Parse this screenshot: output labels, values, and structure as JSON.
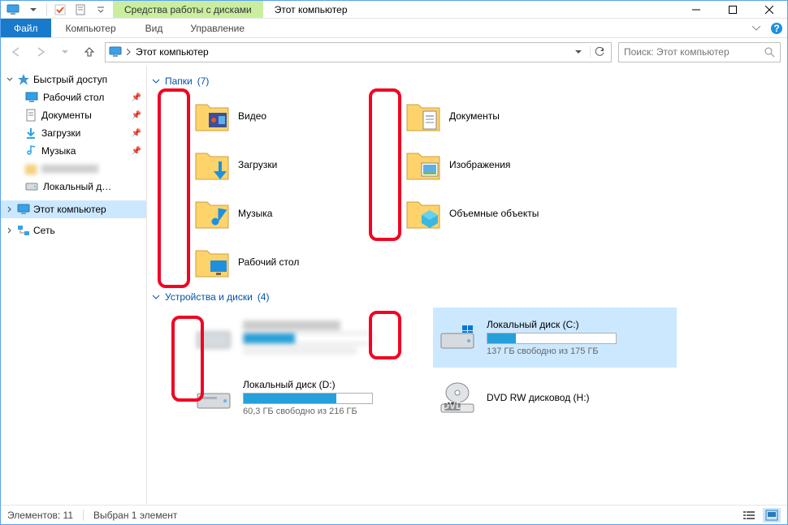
{
  "titlebar": {
    "tools_tab": "Средства работы с дисками",
    "title": "Этот компьютер"
  },
  "ribbon": {
    "file": "Файл",
    "computer": "Компьютер",
    "view": "Вид",
    "manage": "Управление"
  },
  "address": {
    "current": "Этот компьютер"
  },
  "search": {
    "placeholder": "Поиск: Этот компьютер"
  },
  "sidebar": {
    "quick": "Быстрый доступ",
    "quick_items": [
      {
        "label": "Рабочий стол",
        "icon": "desktop"
      },
      {
        "label": "Документы",
        "icon": "doc"
      },
      {
        "label": "Загрузки",
        "icon": "download"
      },
      {
        "label": "Музыка",
        "icon": "music"
      },
      {
        "label": "",
        "icon": "blur"
      },
      {
        "label": "Локальный диск",
        "icon": "drive"
      }
    ],
    "this_pc": "Этот компьютер",
    "network": "Сеть"
  },
  "groups": {
    "folders": {
      "label": "Папки",
      "count": "(7)"
    },
    "drives": {
      "label": "Устройства и диски",
      "count": "(4)"
    }
  },
  "folders_col1": [
    {
      "label": "Видео"
    },
    {
      "label": "Загрузки"
    },
    {
      "label": "Музыка"
    },
    {
      "label": "Рабочий стол"
    }
  ],
  "folders_col2": [
    {
      "label": "Документы"
    },
    {
      "label": "Изображения"
    },
    {
      "label": "Объемные объекты"
    }
  ],
  "drives_col1": [
    {
      "label": "",
      "free": "",
      "used_pct": 40,
      "blurred": true
    },
    {
      "label": "Локальный диск (D:)",
      "free": "60,3 ГБ свободно из 216 ГБ",
      "used_pct": 72
    }
  ],
  "drives_col2": [
    {
      "label": "Локальный диск (C:)",
      "free": "137 ГБ свободно из 175 ГБ",
      "used_pct": 22,
      "selected": true
    },
    {
      "label": "DVD RW дисковод (H:)",
      "type": "dvd"
    }
  ],
  "status": {
    "items": "Элементов: 11",
    "selected": "Выбран 1 элемент"
  }
}
